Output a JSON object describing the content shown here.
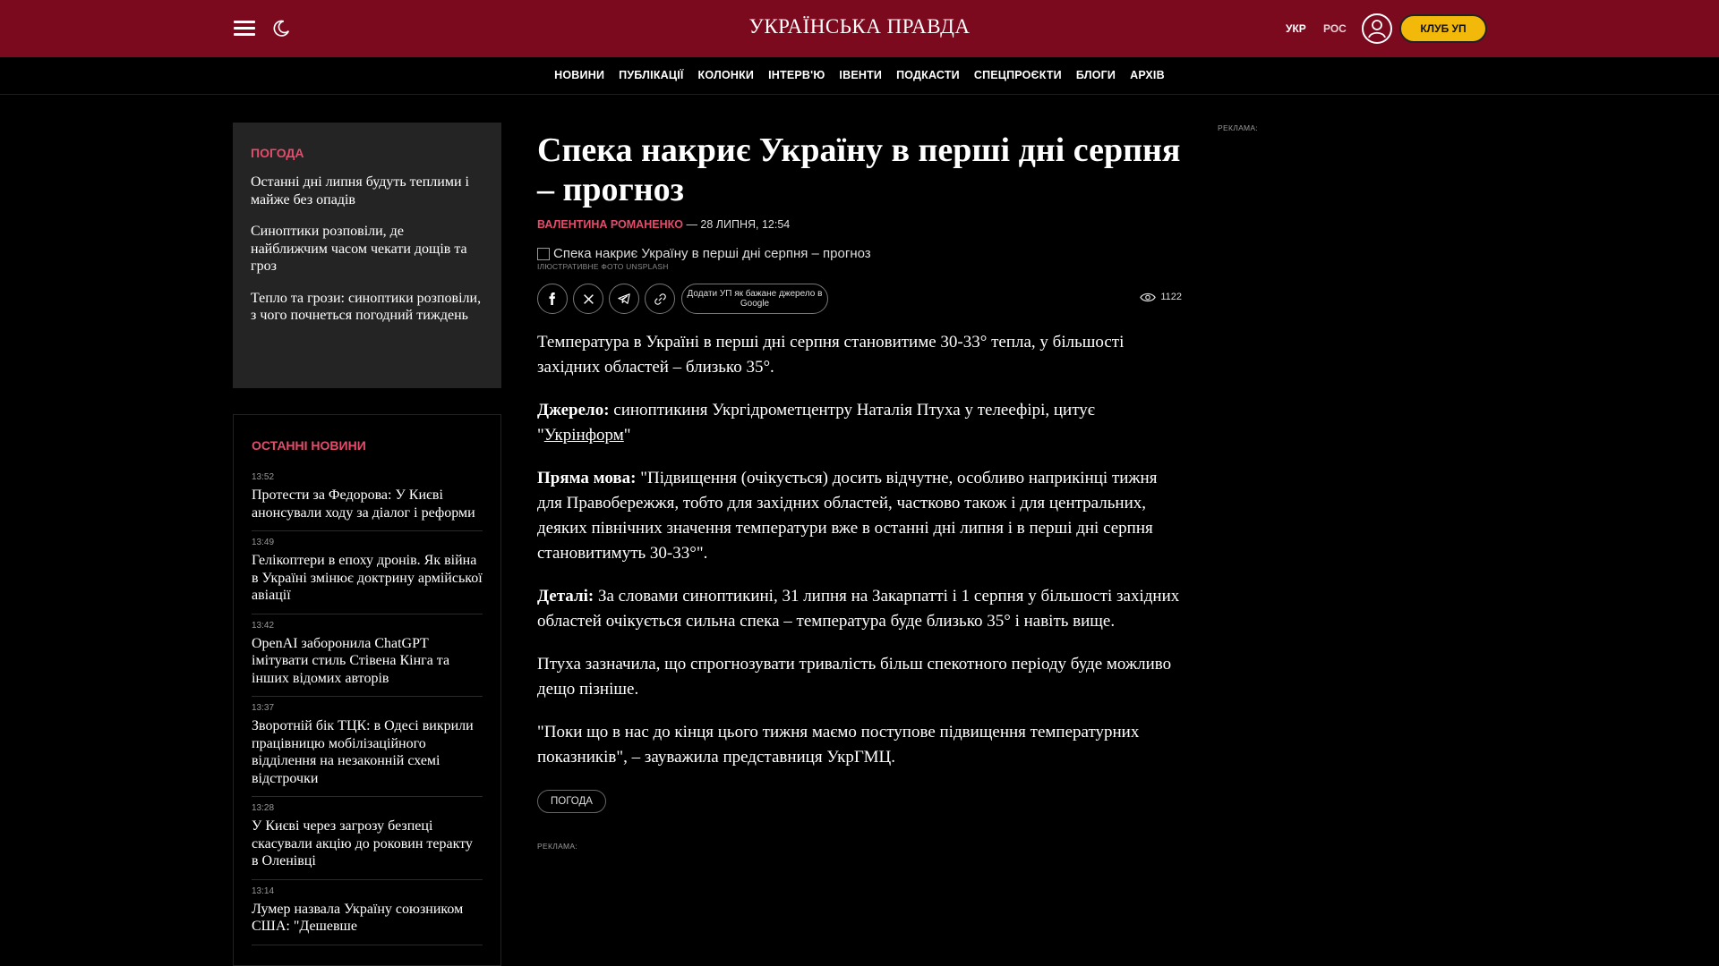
{
  "header": {
    "logo": "УКРАЇНСЬКА ПРАВДА",
    "lang_ukr": "УКР",
    "lang_ros": "РОС",
    "club": "КЛУБ УП"
  },
  "nav": [
    "НОВИНИ",
    "ПУБЛІКАЦІЇ",
    "КОЛОНКИ",
    "ІНТЕРВ'Ю",
    "ІВЕНТИ",
    "ПОДКАСТИ",
    "СПЕЦПРОЄКТИ",
    "БЛОГИ",
    "АРХІВ"
  ],
  "sidebar": {
    "weather_title": "ПОГОДА",
    "weather_items": [
      "Останні дні липня будуть теплими і майже без опадів",
      "Синоптики розповіли, де найближчим часом чекати дощів та гроз",
      "Тепло та грози: синоптики розповіли, з чого почнеться погодний тиждень"
    ],
    "news_title": "ОСТАННІ НОВИНИ",
    "news": [
      {
        "time": "13:52",
        "title": "Протести за Федорова: У Києві анонсували ходу за діалог і реформи"
      },
      {
        "time": "13:49",
        "title": "Гелікоптери в епоху дронів. Як війна в Україні змінює доктрину армійської авіації"
      },
      {
        "time": "13:42",
        "title": "OpenAI заборонила ChatGPT імітувати стиль Стівена Кінга та інших відомих авторів"
      },
      {
        "time": "13:37",
        "title": "Зворотній бік ТЦК: в Одесі викрили працівницю мобілізаційного відділення на незаконній схемі відстрочки"
      },
      {
        "time": "13:28",
        "title": "У Києві через загрозу безпеці скасували акцію до роковин теракту в Оленівці"
      },
      {
        "time": "13:14",
        "title": "Лумер назвала Україну союзником США: \"Дешевше"
      }
    ]
  },
  "article": {
    "title": "Спека накриє Україну в перші дні серпня – прогноз",
    "author": "ВАЛЕНТИНА РОМАНЕНКО",
    "date": "— 28 ЛИПНЯ, 12:54",
    "photo_alt": "Спека накриє Україну в перші дні серпня – прогноз",
    "photo_caption": "ІЛЮСТРАТИВНЕ ФОТО UNSPLASH",
    "google_btn": "Додати УП як бажане джерело в Google",
    "views": "1122",
    "p1": "Температура в Україні в перші дні серпня становитиме 30-33° тепла, у більшості західних областей – близько 35°.",
    "p2_label": "Джерело:",
    "p2_text": " синоптикиня Укргідрометцентру Наталія Птуха у телеефірі, цитує \"",
    "p2_link": "Укрінформ",
    "p2_end": "\"",
    "p3_label": "Пряма мова:",
    "p3_text": " \"Підвищення (очікується) досить відчутне, особливо наприкінці тижня для Правобережжя, тобто для західних областей, частково також і для центральних, деяких північних значення температури вже в останні дні липня і в перші дні серпня становитимуть 30-33°\".",
    "p4_label": "Деталі:",
    "p4_text": " За словами синоптикині, 31 липня на Закарпатті і 1 серпня у більшості західних областей очікується сильна спека – температура буде близько 35° і навіть вище.",
    "p5": "Птуха зазначила, що спрогнозувати тривалість більш спекотного періоду буде можливо дещо пізніше.",
    "p6": "\"Поки що в нас до кінця цього тижня маємо поступове підвищення температурних показників\", – зауважила представниця УкрГМЦ.",
    "tag": "ПОГОДА"
  },
  "ads": {
    "label": "РЕКЛАМА:"
  },
  "colors": {
    "brand_red": "#7c0a1f",
    "accent_pink": "#e34d6c",
    "club_yellow": "#f2b90a"
  }
}
